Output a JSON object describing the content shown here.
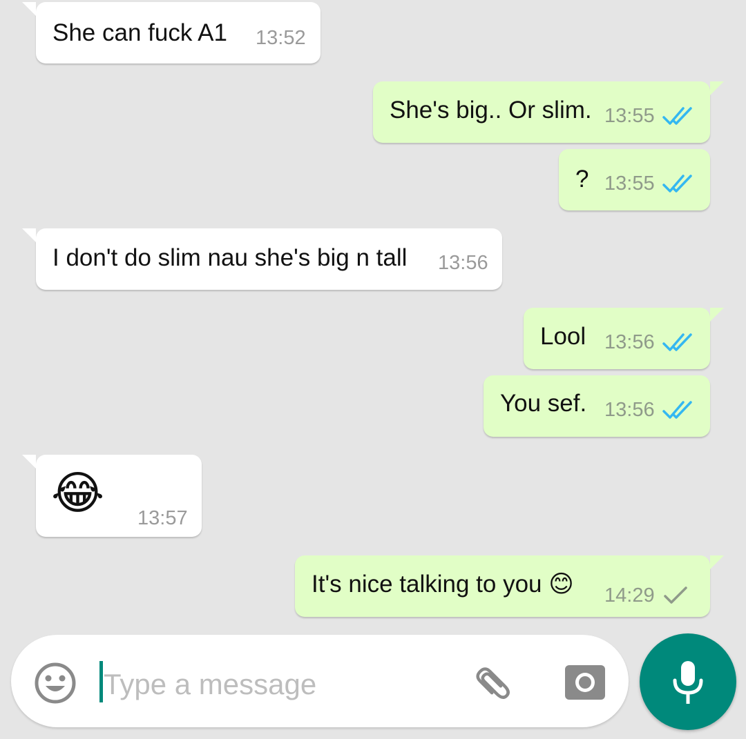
{
  "messages": [
    {
      "direction": "incoming",
      "text": "She can fuck A1",
      "time": "13:52"
    },
    {
      "direction": "outgoing",
      "text": "She's big.. Or slim.",
      "time": "13:55",
      "status": "read"
    },
    {
      "direction": "outgoing",
      "text": "?",
      "time": "13:55",
      "status": "read"
    },
    {
      "direction": "incoming",
      "text": "I don't do slim nau she's big n tall",
      "time": "13:56"
    },
    {
      "direction": "outgoing",
      "text": "Lool",
      "time": "13:56",
      "status": "read"
    },
    {
      "direction": "outgoing",
      "text": "You sef.",
      "time": "13:56",
      "status": "read"
    },
    {
      "direction": "incoming",
      "text": "😂",
      "time": "13:57"
    },
    {
      "direction": "outgoing",
      "text": "It's nice talking to you 😊",
      "time": "14:29",
      "status": "sent"
    }
  ],
  "composer": {
    "placeholder": "Type a message",
    "value": "",
    "icons": [
      "emoji-icon",
      "attachment-icon",
      "camera-icon",
      "microphone-icon"
    ]
  },
  "colors": {
    "background": "#e5e5e5",
    "incoming_bubble": "#ffffff",
    "outgoing_bubble": "#e1fec6",
    "read_tick": "#34b7f1",
    "sent_tick": "#8f9a8a",
    "accent": "#00897b"
  }
}
